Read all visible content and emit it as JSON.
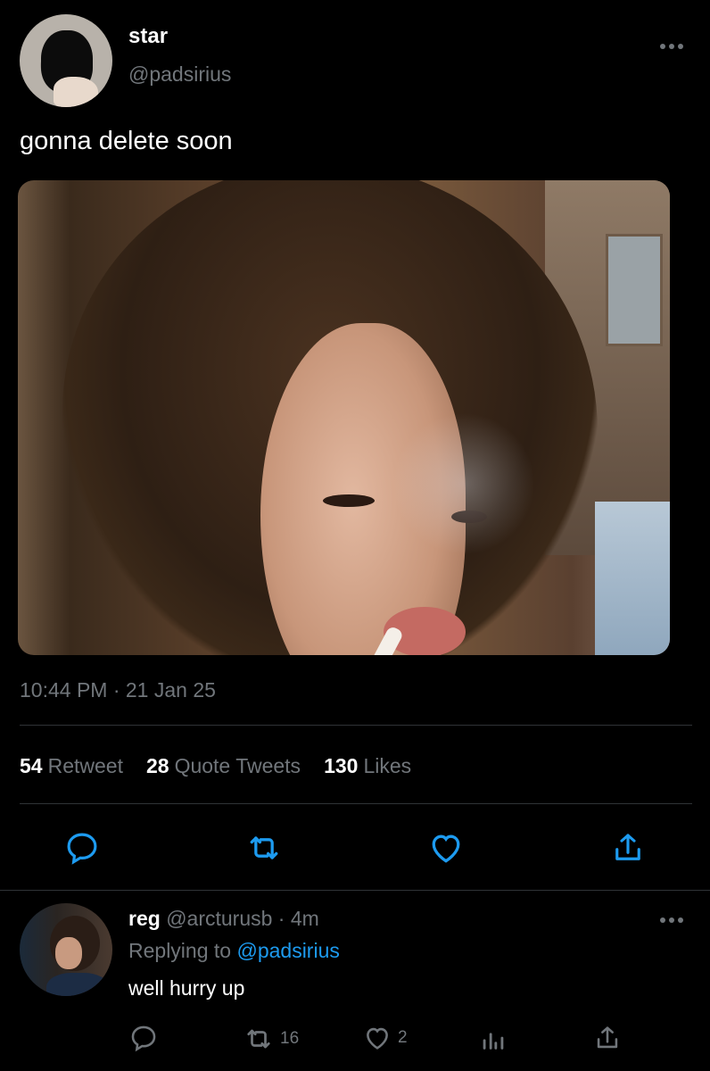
{
  "tweet": {
    "display_name": "star",
    "handle": "@padsirius",
    "more_icon": "more-horizontal-icon",
    "text": "gonna delete soon",
    "timestamp": "10:44 PM · 21 Jan 25",
    "stats": {
      "retweets_count": "54",
      "retweets_label": "Retweet",
      "quotes_count": "28",
      "quotes_label": "Quote Tweets",
      "likes_count": "130",
      "likes_label": "Likes"
    },
    "actions": [
      "reply-icon",
      "retweet-icon",
      "like-icon",
      "share-icon"
    ]
  },
  "reply": {
    "display_name": "reg",
    "handle": "@arcturusb",
    "separator": " · ",
    "time": "4m",
    "replying_to_label": "Replying to ",
    "replying_to_handle": "@padsirius",
    "text": "well hurry up",
    "retweet_count": "16",
    "like_count": "2",
    "more_icon": "more-horizontal-icon"
  },
  "colors": {
    "background": "#000000",
    "secondary_text": "#71767b",
    "link": "#1d9bf0",
    "divider": "#2f3336"
  }
}
